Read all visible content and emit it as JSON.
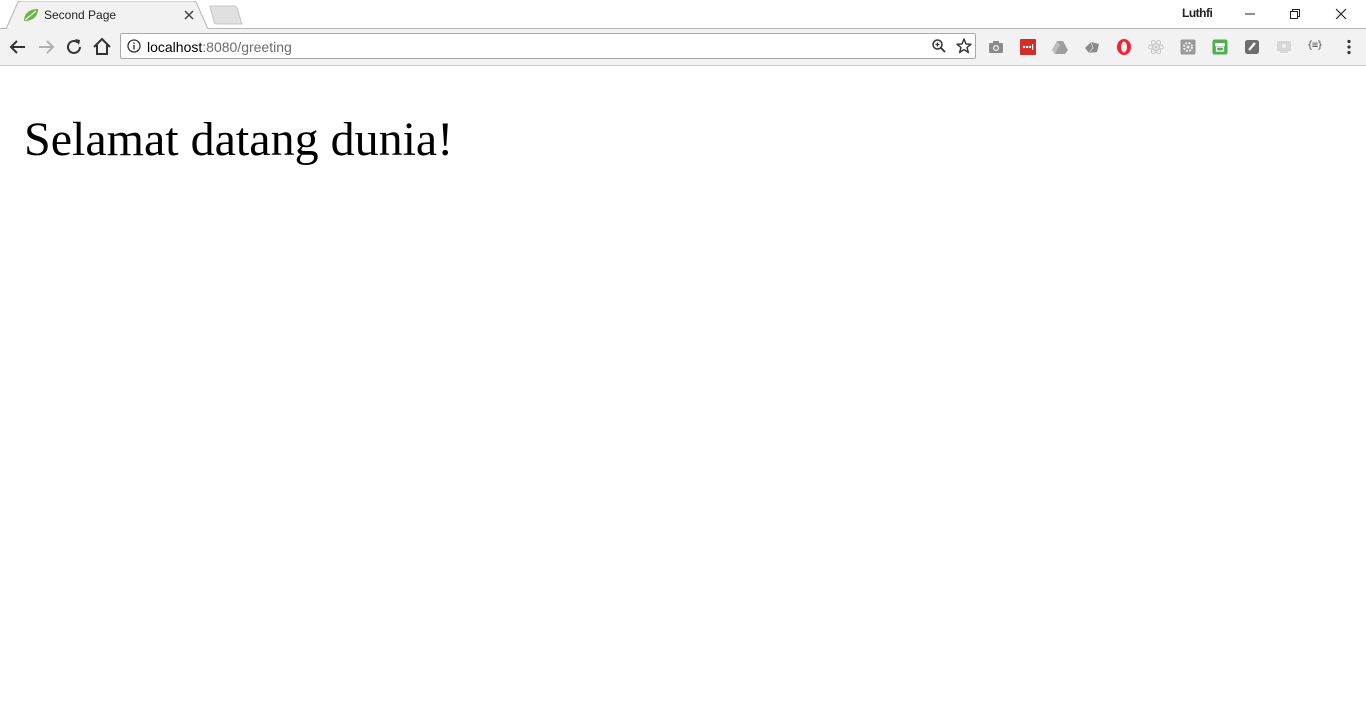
{
  "browser": {
    "active_tab": {
      "title": "Second Page",
      "favicon": "spring-leaf-icon"
    },
    "profile_name": "Luthfi",
    "address_bar": {
      "host": "localhost",
      "path": ":8080/greeting"
    },
    "extensions": [
      "camera-icon",
      "lastpass-icon",
      "drive-icon",
      "eye-icon",
      "opera-icon",
      "react-icon",
      "gear-icon",
      "green-square-icon",
      "notebook-icon",
      "cast-icon",
      "json-icon"
    ],
    "json_extension_label": "{≡}"
  },
  "page": {
    "heading": "Selamat datang dunia!"
  },
  "colors": {
    "favicon_green": "#6db33f",
    "lastpass_red": "#d32d27",
    "opera_red": "#ff1b2d",
    "green_ext": "#4caf50"
  }
}
